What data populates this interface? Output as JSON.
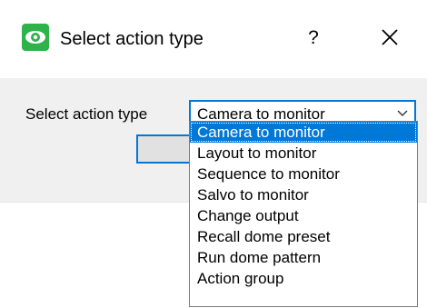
{
  "dialog": {
    "title": "Select action type",
    "help_label": "?",
    "icon": "eye-icon",
    "close_icon": "close-icon"
  },
  "form": {
    "label": "Select action type",
    "selected_value": "Camera to monitor",
    "arrow_icon": "chevron-down-icon"
  },
  "dropdown": {
    "options": [
      "Camera to monitor",
      "Layout to monitor",
      "Sequence to monitor",
      "Salvo to monitor",
      "Change output",
      "Recall dome preset",
      "Run dome pattern",
      "Action group"
    ]
  },
  "colors": {
    "accent": "#0078d7",
    "icon_green": "#2db34a",
    "dialog_body": "#f0f0f0"
  }
}
